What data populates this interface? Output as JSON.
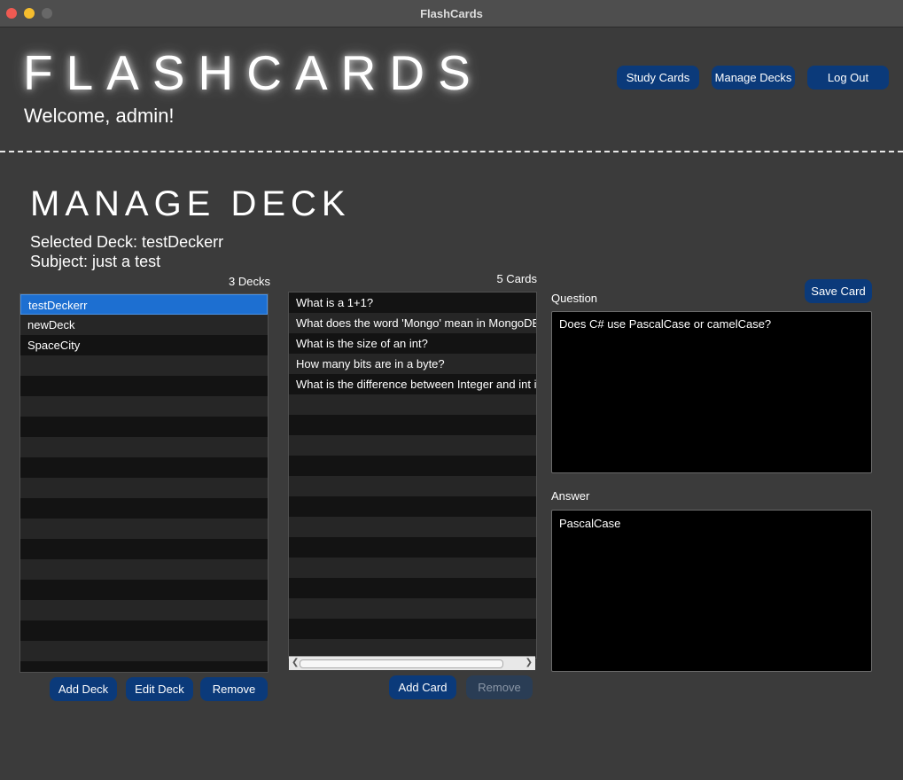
{
  "window": {
    "title": "FlashCards"
  },
  "header": {
    "brand": "FLASHCARDS",
    "welcome": "Welcome, admin!",
    "nav": {
      "study": "Study Cards",
      "manage": "Manage Decks",
      "logout": "Log Out"
    }
  },
  "manage": {
    "title": "MANAGE DECK",
    "selected_deck": "Selected Deck: testDeckerr",
    "subject": "Subject: just a test"
  },
  "decks": {
    "count_label": "3 Decks",
    "items": [
      "testDeckerr",
      "newDeck",
      "SpaceCity"
    ],
    "selected_index": 0,
    "buttons": {
      "add": "Add Deck",
      "edit": "Edit Deck",
      "remove": "Remove"
    }
  },
  "cards": {
    "count_label": "5 Cards",
    "items": [
      "What is a 1+1?",
      "What does the word 'Mongo' mean in MongoDB?",
      "What is the size of an int?",
      "How many bits are in a byte?",
      "What is the difference between Integer and int in java?"
    ],
    "buttons": {
      "add": "Add Card",
      "remove": "Remove"
    }
  },
  "editor": {
    "save_label": "Save Card",
    "question_label": "Question",
    "question_value": "Does C# use PascalCase or camelCase?",
    "answer_label": "Answer",
    "answer_value": "PascalCase"
  }
}
